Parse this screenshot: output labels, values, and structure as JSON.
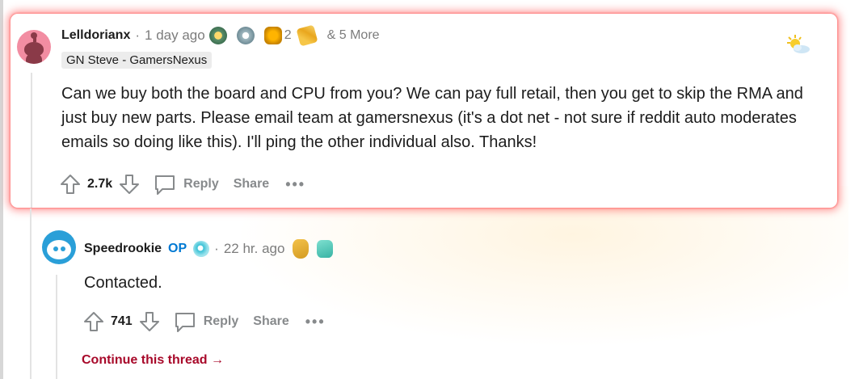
{
  "comment": {
    "username": "Lelldorianx",
    "separator": "·",
    "time": "1 day ago",
    "award_count": "2",
    "more_awards": "& 5 More",
    "flair": "GN Steve - GamersNexus",
    "body": "Can we buy both the board and CPU from you? We can pay full retail, then you get to skip the RMA and just buy new parts. Please email team at gamersnexus (it's a dot net - not sure if reddit auto moderates emails so doing like this). I'll ping the other individual also. Thanks!",
    "score": "2.7k",
    "reply_label": "Reply",
    "share_label": "Share",
    "more_label": "•••"
  },
  "reply": {
    "username": "Speedrookie",
    "op_badge": "OP",
    "separator": "·",
    "time": "22 hr. ago",
    "body": "Contacted.",
    "score": "741",
    "reply_label": "Reply",
    "share_label": "Share",
    "more_label": "•••",
    "continue_label": "Continue this thread",
    "continue_arrow": "→"
  },
  "colors": {
    "highlight_glow": "#ff5a5a",
    "op_blue": "#0079d3",
    "continue_red": "#a8092a",
    "muted": "#878a8c"
  },
  "icons": [
    "upvote-icon",
    "downvote-icon",
    "reply-bubble-icon",
    "sun-cloud-award-icon",
    "award-icon"
  ]
}
